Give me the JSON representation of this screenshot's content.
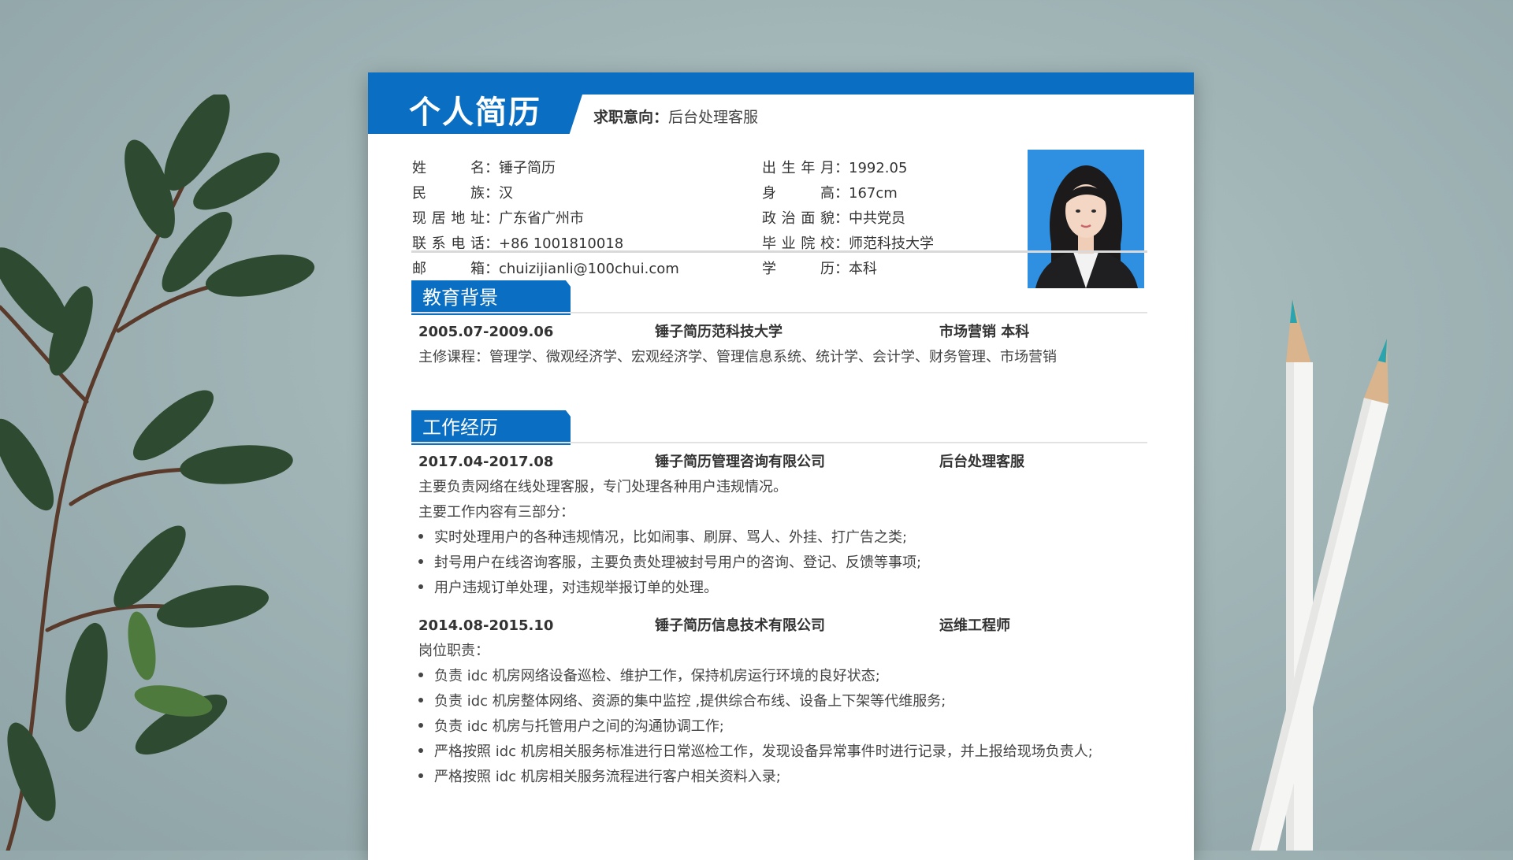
{
  "resume": {
    "title": "个人简历",
    "intent_label": "求职意向：",
    "intent_value": "后台处理客服",
    "info_left": [
      {
        "label": "姓名",
        "sep": "：",
        "value": "锤子简历"
      },
      {
        "label": "民族",
        "sep": "：",
        "value": "汉"
      },
      {
        "label": "现居地址",
        "sep": "：",
        "value": "广东省广州市"
      },
      {
        "label": "联系电话",
        "sep": "：",
        "value": "+86 1001810018"
      },
      {
        "label": "邮箱",
        "sep": "：",
        "value": "chuizijianli@100chui.com"
      }
    ],
    "info_right": [
      {
        "label": "出生年月",
        "sep": "：",
        "value": "1992.05"
      },
      {
        "label": "身高",
        "sep": "：",
        "value": "167cm"
      },
      {
        "label": "政治面貌",
        "sep": "：",
        "value": "中共党员"
      },
      {
        "label": "毕业院校",
        "sep": "：",
        "value": "师范科技大学"
      },
      {
        "label": "学历",
        "sep": "：",
        "value": "本科"
      }
    ],
    "education": {
      "heading": "教育背景",
      "period": "2005.07-2009.06",
      "school": "锤子简历范科技大学",
      "major": "市场营销  本科",
      "courses": "主修课程：管理学、微观经济学、宏观经济学、管理信息系统、统计学、会计学、财务管理、市场营销"
    },
    "work": {
      "heading": "工作经历",
      "jobs": [
        {
          "period": "2017.04-2017.08",
          "company": "锤子简历管理咨询有限公司",
          "role": "后台处理客服",
          "lines": [
            "主要负责网络在线处理客服，专门处理各种用户违规情况。",
            "主要工作内容有三部分："
          ],
          "bullets": [
            "实时处理用户的各种违规情况，比如闹事、刷屏、骂人、外挂、打广告之类;",
            "封号用户在线咨询客服，主要负责处理被封号用户的咨询、登记、反馈等事项;",
            "用户违规订单处理，对违规举报订单的处理。"
          ]
        },
        {
          "period": "2014.08-2015.10",
          "company": "锤子简历信息技术有限公司",
          "role": "运维工程师",
          "lines": [
            "岗位职责："
          ],
          "bullets": [
            "负责 idc 机房网络设备巡检、维护工作，保持机房运行环境的良好状态;",
            "负责 idc 机房整体网络、资源的集中监控 ,提供综合布线、设备上下架等代维服务;",
            "负责 idc 机房与托管用户之间的沟通协调工作;",
            "严格按照 idc 机房相关服务标准进行日常巡检工作，发现设备异常事件时进行记录，并上报给现场负责人;",
            "严格按照 idc 机房相关服务流程进行客户相关资料入录;"
          ]
        }
      ]
    }
  }
}
